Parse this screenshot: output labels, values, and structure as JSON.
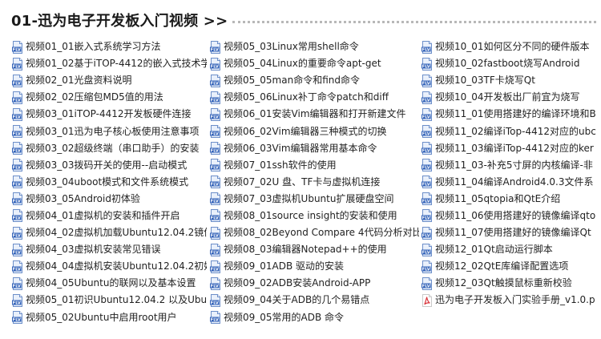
{
  "header": {
    "title": "01-迅为电子开发板入门视频 >>"
  },
  "icons": {
    "video": "flv-file-icon",
    "pdf": "pdf-file-icon"
  },
  "colors": {
    "flv_bar": "#2e5fb7",
    "flv_sheet": "#e9f0fb",
    "pdf": "#d9343b",
    "rule": "#b8b8b8"
  },
  "columns": [
    {
      "items": [
        {
          "label": "视频01_01嵌入式系统学习方法",
          "type": "video"
        },
        {
          "label": "视频01_02基于iTOP-4412的嵌入式技术学",
          "type": "video"
        },
        {
          "label": "视频02_01光盘资料说明",
          "type": "video"
        },
        {
          "label": "视频02_02压缩包MD5值的用法",
          "type": "video"
        },
        {
          "label": "视频03_01iTOP-4412开发板硬件连接",
          "type": "video"
        },
        {
          "label": "视频03_01迅为电子核心板使用注意事项",
          "type": "video"
        },
        {
          "label": "视频03_02超级终端（串口助手）的安装",
          "type": "video"
        },
        {
          "label": "视频03_03拨码开关的使用--启动模式",
          "type": "video"
        },
        {
          "label": "视频03_04uboot模式和文件系统模式",
          "type": "video"
        },
        {
          "label": "视频03_05Android初体验",
          "type": "video"
        },
        {
          "label": "视频04_01虚拟机的安装和插件开启",
          "type": "video"
        },
        {
          "label": "视频04_02虚拟机加载Ubuntu12.04.2镜像",
          "type": "video"
        },
        {
          "label": "视频04_03虚拟机安装常见错误",
          "type": "video"
        },
        {
          "label": "视频04_04虚拟机安装Ubuntu12.04.2初始",
          "type": "video"
        },
        {
          "label": "视频04_05Ubuntu的联网以及基本设置",
          "type": "video"
        },
        {
          "label": "视频05_01初识Ubuntu12.04.2 以及Ubu",
          "type": "video"
        },
        {
          "label": "视频05_02Ubuntu中启用root用户",
          "type": "video"
        }
      ]
    },
    {
      "items": [
        {
          "label": "视频05_03Linux常用shell命令",
          "type": "video"
        },
        {
          "label": "视频05_04Linux的重要命令apt-get",
          "type": "video"
        },
        {
          "label": "视频05_05man命令和find命令",
          "type": "video"
        },
        {
          "label": "视频05_06Linux补丁命令patch和diff",
          "type": "video"
        },
        {
          "label": "视频06_01安装Vim编辑器和打开新建文件",
          "type": "video"
        },
        {
          "label": "视频06_02Vim编辑器三种模式的切换",
          "type": "video"
        },
        {
          "label": "视频06_03Vim编辑器常用基本命令",
          "type": "video"
        },
        {
          "label": "视频07_01ssh软件的使用",
          "type": "video"
        },
        {
          "label": "视频07_02U 盘、TF卡与虚拟机连接",
          "type": "video"
        },
        {
          "label": "视频07_03虚拟机Ubuntu扩展硬盘空间",
          "type": "video"
        },
        {
          "label": "视频08_01source insight的安装和使用",
          "type": "video"
        },
        {
          "label": "视频08_02Beyond Compare 4代码分析对比",
          "type": "video"
        },
        {
          "label": "视频08_03编辑器Notepad++的使用",
          "type": "video"
        },
        {
          "label": "视频09_01ADB 驱动的安装",
          "type": "video"
        },
        {
          "label": "视频09_02ADB安装Android-APP",
          "type": "video"
        },
        {
          "label": "视频09_04关于ADB的几个易错点",
          "type": "video"
        },
        {
          "label": "视频09_05常用的ADB 命令",
          "type": "video"
        }
      ]
    },
    {
      "items": [
        {
          "label": "视频10_01如何区分不同的硬件版本",
          "type": "video"
        },
        {
          "label": "视频10_02fastboot烧写Android",
          "type": "video"
        },
        {
          "label": "视频10_03TF卡烧写Qt",
          "type": "video"
        },
        {
          "label": "视频10_04开发板出厂前宜为烧写",
          "type": "video"
        },
        {
          "label": "视频11_01使用搭建好的编译环境和B",
          "type": "video"
        },
        {
          "label": "视频11_02编译iTop-4412对应的ubc",
          "type": "video"
        },
        {
          "label": "视频11_03编译iTop-4412对应的ker",
          "type": "video"
        },
        {
          "label": "视频11_03-补充5寸屏的内核编译-非",
          "type": "video"
        },
        {
          "label": "视频11_04编译Android4.0.3文件系",
          "type": "video"
        },
        {
          "label": "视频11_05qtopia和QtE介绍",
          "type": "video"
        },
        {
          "label": "视频11_06使用搭建好的镜像编译qto",
          "type": "video"
        },
        {
          "label": "视频11_07使用搭建好的镜像编译Qt",
          "type": "video"
        },
        {
          "label": "视频12_01Qt启动运行脚本",
          "type": "video"
        },
        {
          "label": "视频12_02QtE库编译配置选项",
          "type": "video"
        },
        {
          "label": "视频12_03Qt触摸鼠标重新校验",
          "type": "video"
        },
        {
          "label": "迅为电子开发板入门实验手册_v1.0.p",
          "type": "pdf"
        }
      ]
    }
  ]
}
